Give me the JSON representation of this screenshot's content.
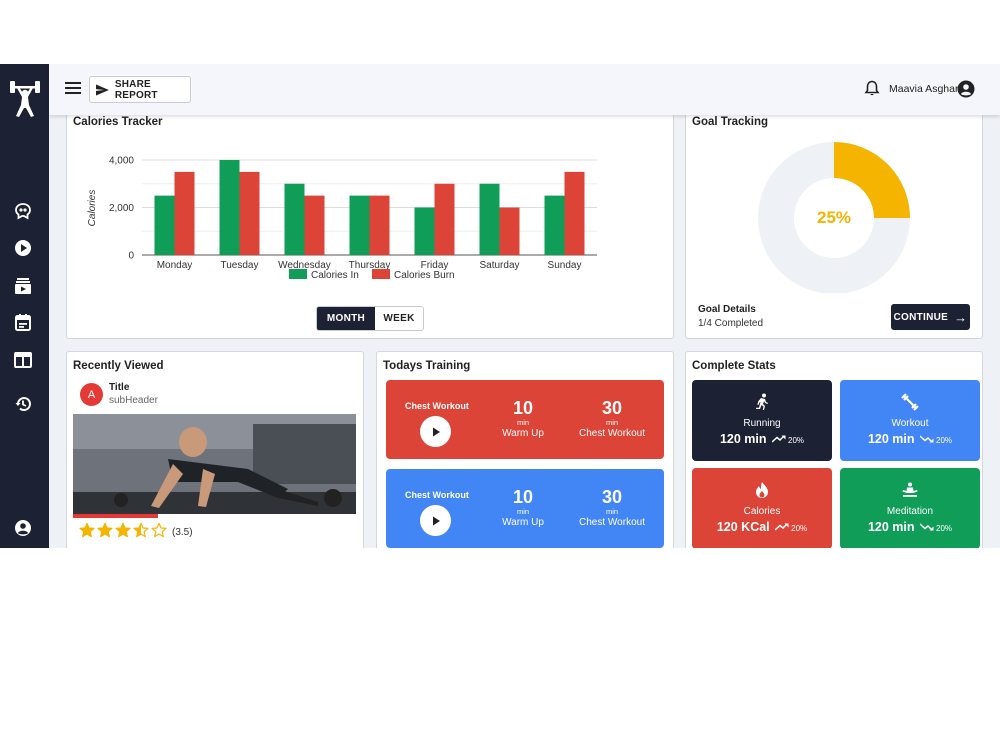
{
  "topbar": {
    "share_label": "SHARE REPORT",
    "user_name": "Maavia Asghar"
  },
  "calories": {
    "title": "Calories Tracker",
    "toggle": {
      "month": "MONTH",
      "week": "WEEK",
      "selected": "MONTH"
    }
  },
  "chart_data": {
    "type": "bar",
    "title": "",
    "xlabel": "",
    "ylabel": "Calories",
    "categories": [
      "Monday",
      "Tuesday",
      "Wednesday",
      "Thursday",
      "Friday",
      "Saturday",
      "Sunday"
    ],
    "series": [
      {
        "name": "Calories In",
        "color": "#0f9d58",
        "values": [
          2500,
          4000,
          3000,
          2500,
          2000,
          3000,
          2500
        ]
      },
      {
        "name": "Calories Burn",
        "color": "#db4437",
        "values": [
          3500,
          3500,
          2500,
          2500,
          3000,
          2000,
          3500
        ]
      }
    ],
    "ylim": [
      0,
      4000
    ],
    "yticks": [
      0,
      2000,
      4000
    ],
    "ytick_labels": [
      "0",
      "2,000",
      "4,000"
    ],
    "grid": true,
    "legend": "bottom"
  },
  "goal": {
    "title": "Goal Tracking",
    "percent": 25,
    "percent_label": "25%",
    "details_label": "Goal Details",
    "completed_label": "1/4 Completed",
    "continue_label": "CONTINUE",
    "colors": {
      "progress": "#f4b400",
      "track": "#eef1f6"
    }
  },
  "recent": {
    "title": "Recently Viewed",
    "avatar_letter": "A",
    "item_title": "Title",
    "item_subheader": "subHeader",
    "progress": 0.3,
    "rating": 3.5,
    "rating_label": "(3.5)"
  },
  "training": {
    "title": "Todays Training",
    "cards": [
      {
        "label": "Chest Workout",
        "color": "#db4437",
        "stat1_num": "10",
        "stat1_unit": "min",
        "stat1_label": "Warm Up",
        "stat2_num": "30",
        "stat2_unit": "min",
        "stat2_label": "Chest Workout"
      },
      {
        "label": "Chest Workout",
        "color": "#4285f4",
        "stat1_num": "10",
        "stat1_unit": "min",
        "stat1_label": "Warm Up",
        "stat2_num": "30",
        "stat2_unit": "min",
        "stat2_label": "Chest Workout"
      }
    ]
  },
  "stats": {
    "title": "Complete Stats",
    "cards": [
      {
        "name": "Running",
        "value": "120 min",
        "trend": "20%",
        "trend_dir": "up",
        "color": "#1d2134",
        "icon": "running-icon"
      },
      {
        "name": "Workout",
        "value": "120 min",
        "trend": "20%",
        "trend_dir": "down",
        "color": "#4285f4",
        "icon": "dumbbell-icon"
      },
      {
        "name": "Calories",
        "value": "120 KCal",
        "trend": "20%",
        "trend_dir": "up",
        "color": "#db4437",
        "icon": "fire-icon"
      },
      {
        "name": "Meditation",
        "value": "120 min",
        "trend": "20%",
        "trend_dir": "down",
        "color": "#0f9d58",
        "icon": "meditation-icon"
      }
    ]
  }
}
